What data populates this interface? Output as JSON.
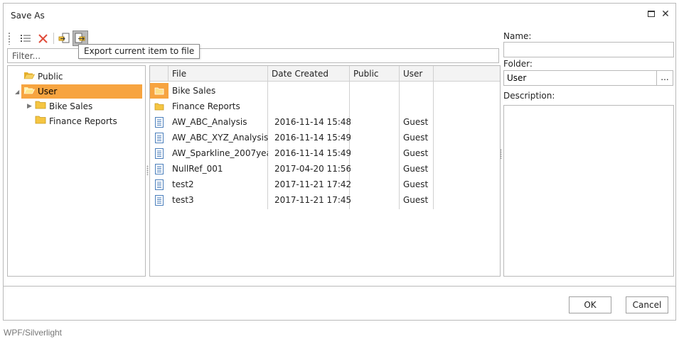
{
  "dialog": {
    "title": "Save As",
    "maximize_icon": "maximize-icon",
    "close_icon": "close-icon"
  },
  "toolbar": {
    "buttons": [
      "details-view-icon",
      "delete-icon",
      "import-icon",
      "export-icon"
    ],
    "tooltip": "Export current item to file"
  },
  "filter": {
    "placeholder": "Filter..."
  },
  "tree": {
    "items": [
      {
        "label": "Public",
        "icon": "open-folder-icon"
      },
      {
        "label": "User",
        "icon": "open-folder-icon",
        "selected": true
      },
      {
        "label": "Bike Sales",
        "icon": "folder-icon"
      },
      {
        "label": "Finance Reports",
        "icon": "folder-icon"
      }
    ]
  },
  "grid": {
    "columns": [
      "File",
      "Date Created",
      "Public",
      "User"
    ],
    "rows": [
      {
        "type": "folder",
        "file": "Bike Sales",
        "date": "",
        "public": "",
        "user": ""
      },
      {
        "type": "folder",
        "file": "Finance Reports",
        "date": "",
        "public": "",
        "user": ""
      },
      {
        "type": "file",
        "file": "AW_ABC_Analysis",
        "date": "2016-11-14 15:48",
        "public": "",
        "user": "Guest"
      },
      {
        "type": "file",
        "file": "AW_ABC_XYZ_Analysis",
        "date": "2016-11-14 15:49",
        "public": "",
        "user": "Guest"
      },
      {
        "type": "file",
        "file": "AW_Sparkline_2007yea",
        "date": "2016-11-14 15:49",
        "public": "",
        "user": "Guest"
      },
      {
        "type": "file",
        "file": "NullRef_001",
        "date": "2017-04-20 11:56",
        "public": "",
        "user": "Guest"
      },
      {
        "type": "file",
        "file": "test2",
        "date": "2017-11-21 17:42",
        "public": "",
        "user": "Guest"
      },
      {
        "type": "file",
        "file": "test3",
        "date": "2017-11-21 17:45",
        "public": "",
        "user": "Guest"
      }
    ]
  },
  "form": {
    "name_label": "Name:",
    "name_value": "",
    "folder_label": "Folder:",
    "folder_value": "User",
    "browse_label": "...",
    "description_label": "Description:",
    "description_value": ""
  },
  "buttons": {
    "ok": "OK",
    "cancel": "Cancel"
  },
  "caption": "WPF/Silverlight",
  "colors": {
    "selection": "#f7a440",
    "folder": "#f5c542",
    "file_icon": "#4a7ebb",
    "delete": "#e04b3a",
    "border": "#b9b9b9"
  }
}
